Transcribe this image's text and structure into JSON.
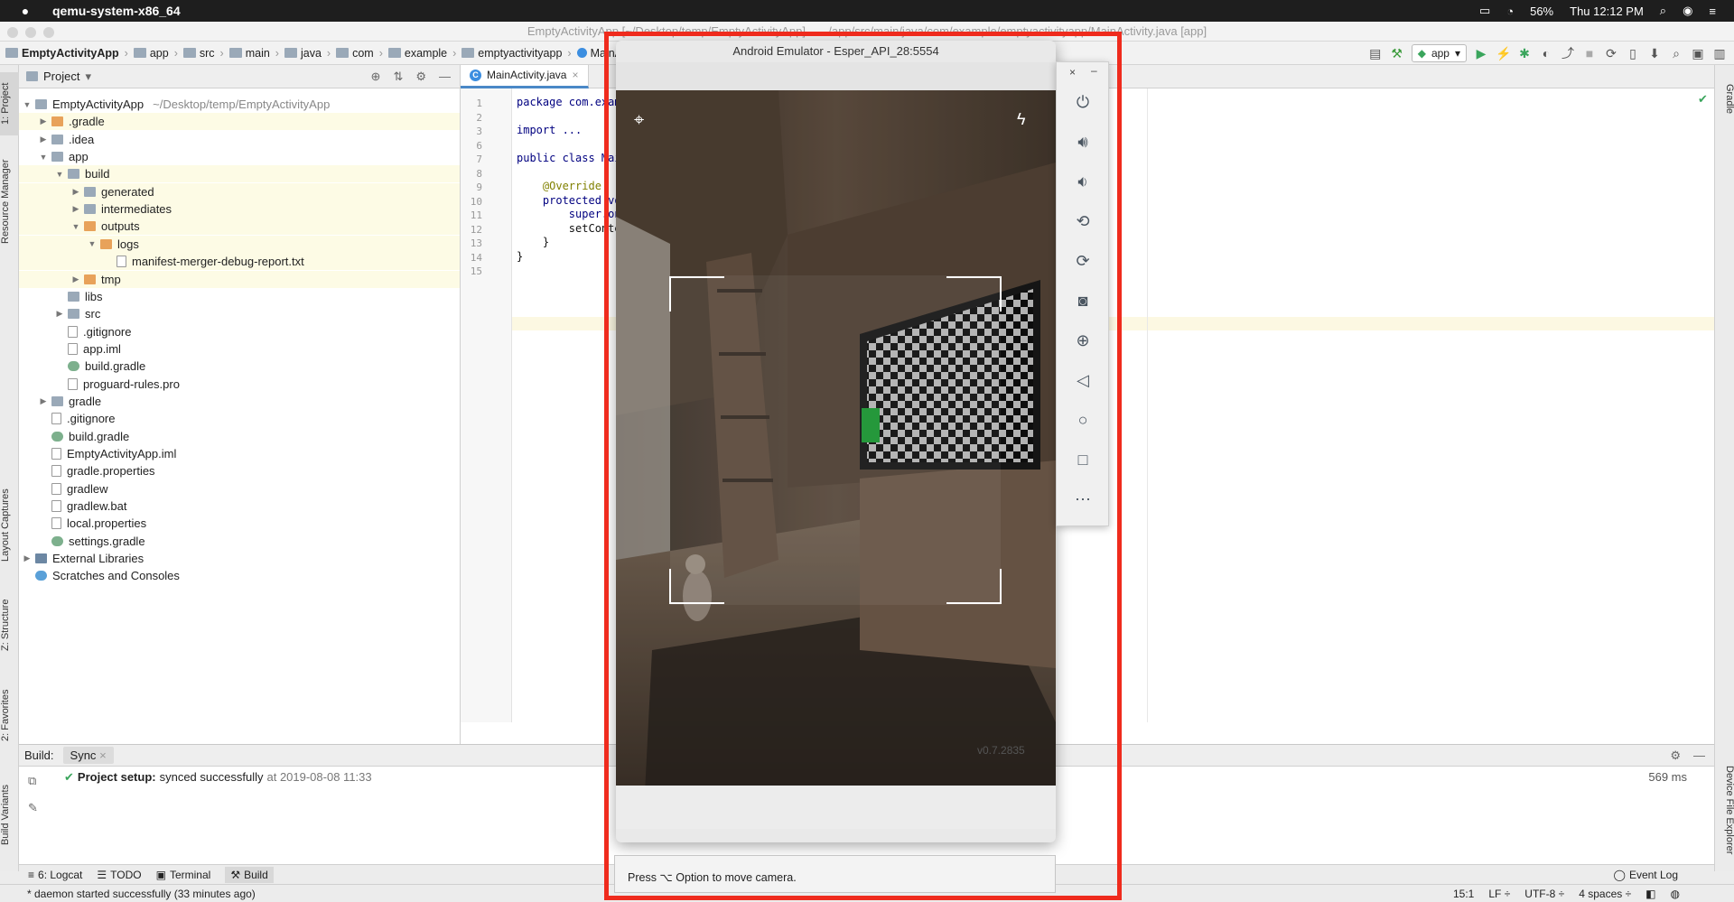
{
  "menubar": {
    "app": "qemu-system-x86_64",
    "battery": "56%",
    "clock": "Thu 12:12 PM"
  },
  "window": {
    "title": "EmptyActivityApp [~/Desktop/temp/EmptyActivityApp] – .../app/src/main/java/com/example/emptyactivityapp/MainActivity.java [app]"
  },
  "breadcrumb": [
    "EmptyActivityApp",
    "app",
    "src",
    "main",
    "java",
    "com",
    "example",
    "emptyactivityapp",
    "MainActivity"
  ],
  "toolbar": {
    "run_config": "app"
  },
  "project_panel": {
    "header": "Project",
    "tree": [
      {
        "label": "EmptyActivityApp",
        "extra": "~/Desktop/temp/EmptyActivityApp",
        "depth": 0,
        "arrow": "open",
        "icon": "folder"
      },
      {
        "label": ".gradle",
        "depth": 1,
        "arrow": "closed",
        "icon": "orange",
        "highlight": true
      },
      {
        "label": ".idea",
        "depth": 1,
        "arrow": "closed",
        "icon": "folder"
      },
      {
        "label": "app",
        "depth": 1,
        "arrow": "open",
        "icon": "folder"
      },
      {
        "label": "build",
        "depth": 2,
        "arrow": "open",
        "icon": "folder",
        "highlight": true
      },
      {
        "label": "generated",
        "depth": 3,
        "arrow": "closed",
        "icon": "folder",
        "highlight": true
      },
      {
        "label": "intermediates",
        "depth": 3,
        "arrow": "closed",
        "icon": "folder",
        "highlight": true
      },
      {
        "label": "outputs",
        "depth": 3,
        "arrow": "open",
        "icon": "orange",
        "highlight": true
      },
      {
        "label": "logs",
        "depth": 4,
        "arrow": "open",
        "icon": "orange",
        "highlight": true
      },
      {
        "label": "manifest-merger-debug-report.txt",
        "depth": 5,
        "arrow": "none",
        "icon": "file",
        "highlight": true
      },
      {
        "label": "tmp",
        "depth": 3,
        "arrow": "closed",
        "icon": "orange",
        "highlight": true
      },
      {
        "label": "libs",
        "depth": 2,
        "arrow": "none",
        "icon": "folder"
      },
      {
        "label": "src",
        "depth": 2,
        "arrow": "closed",
        "icon": "folder"
      },
      {
        "label": ".gitignore",
        "depth": 2,
        "arrow": "none",
        "icon": "file"
      },
      {
        "label": "app.iml",
        "depth": 2,
        "arrow": "none",
        "icon": "file"
      },
      {
        "label": "build.gradle",
        "depth": 2,
        "arrow": "none",
        "icon": "gradle"
      },
      {
        "label": "proguard-rules.pro",
        "depth": 2,
        "arrow": "none",
        "icon": "file"
      },
      {
        "label": "gradle",
        "depth": 1,
        "arrow": "closed",
        "icon": "folder"
      },
      {
        "label": ".gitignore",
        "depth": 1,
        "arrow": "none",
        "icon": "file"
      },
      {
        "label": "build.gradle",
        "depth": 1,
        "arrow": "none",
        "icon": "gradle"
      },
      {
        "label": "EmptyActivityApp.iml",
        "depth": 1,
        "arrow": "none",
        "icon": "file"
      },
      {
        "label": "gradle.properties",
        "depth": 1,
        "arrow": "none",
        "icon": "file"
      },
      {
        "label": "gradlew",
        "depth": 1,
        "arrow": "none",
        "icon": "file"
      },
      {
        "label": "gradlew.bat",
        "depth": 1,
        "arrow": "none",
        "icon": "file"
      },
      {
        "label": "local.properties",
        "depth": 1,
        "arrow": "none",
        "icon": "file"
      },
      {
        "label": "settings.gradle",
        "depth": 1,
        "arrow": "none",
        "icon": "gradle"
      },
      {
        "label": "External Libraries",
        "depth": 0,
        "arrow": "closed",
        "icon": "lib"
      },
      {
        "label": "Scratches and Consoles",
        "depth": 0,
        "arrow": "none",
        "icon": "scr"
      }
    ]
  },
  "editor": {
    "tab": "MainActivity.java",
    "line_numbers": [
      "1",
      "2",
      "3",
      "6",
      "7",
      "8",
      "9",
      "10",
      "11",
      "12",
      "13",
      "14",
      "15"
    ],
    "lines": [
      "package com.exam",
      "",
      "import ...",
      "",
      "public class Mai",
      "",
      "    @Override",
      "    protected vo",
      "        super.on",
      "        setConte",
      "    }",
      "}",
      ""
    ]
  },
  "left_tabs": [
    "1: Project",
    "Resource Manager",
    "Layout Captures",
    "Z: Structure",
    "2: Favorites",
    "Build Variants"
  ],
  "right_tabs": [
    "Gradle",
    "Device File Explorer"
  ],
  "build_panel": {
    "label": "Build:",
    "tab": "Sync",
    "message_bold": "Project setup:",
    "message": "synced successfully",
    "timestamp": "at 2019-08-08 11:33",
    "duration": "569 ms"
  },
  "bottom_tools": [
    {
      "icon": "logcat-icon",
      "label": "6: Logcat"
    },
    {
      "icon": "todo-icon",
      "label": "TODO"
    },
    {
      "icon": "terminal-icon",
      "label": "Terminal"
    },
    {
      "icon": "build-icon",
      "label": "Build"
    }
  ],
  "event_log": "Event Log",
  "status": {
    "message": "* daemon started successfully (33 minutes ago)",
    "position": "15:1",
    "line_sep": "LF ÷",
    "encoding": "UTF-8 ÷",
    "indent": "4 spaces ÷"
  },
  "emulator": {
    "title": "Android Emulator - Esper_API_28:5554",
    "hint": "Press ⌥ Option to move camera.",
    "screen_text": "v0.7.2835"
  },
  "colors": {
    "accent": "#4a88c7",
    "red_box": "#ef2b1d",
    "success": "#3aa55c"
  }
}
